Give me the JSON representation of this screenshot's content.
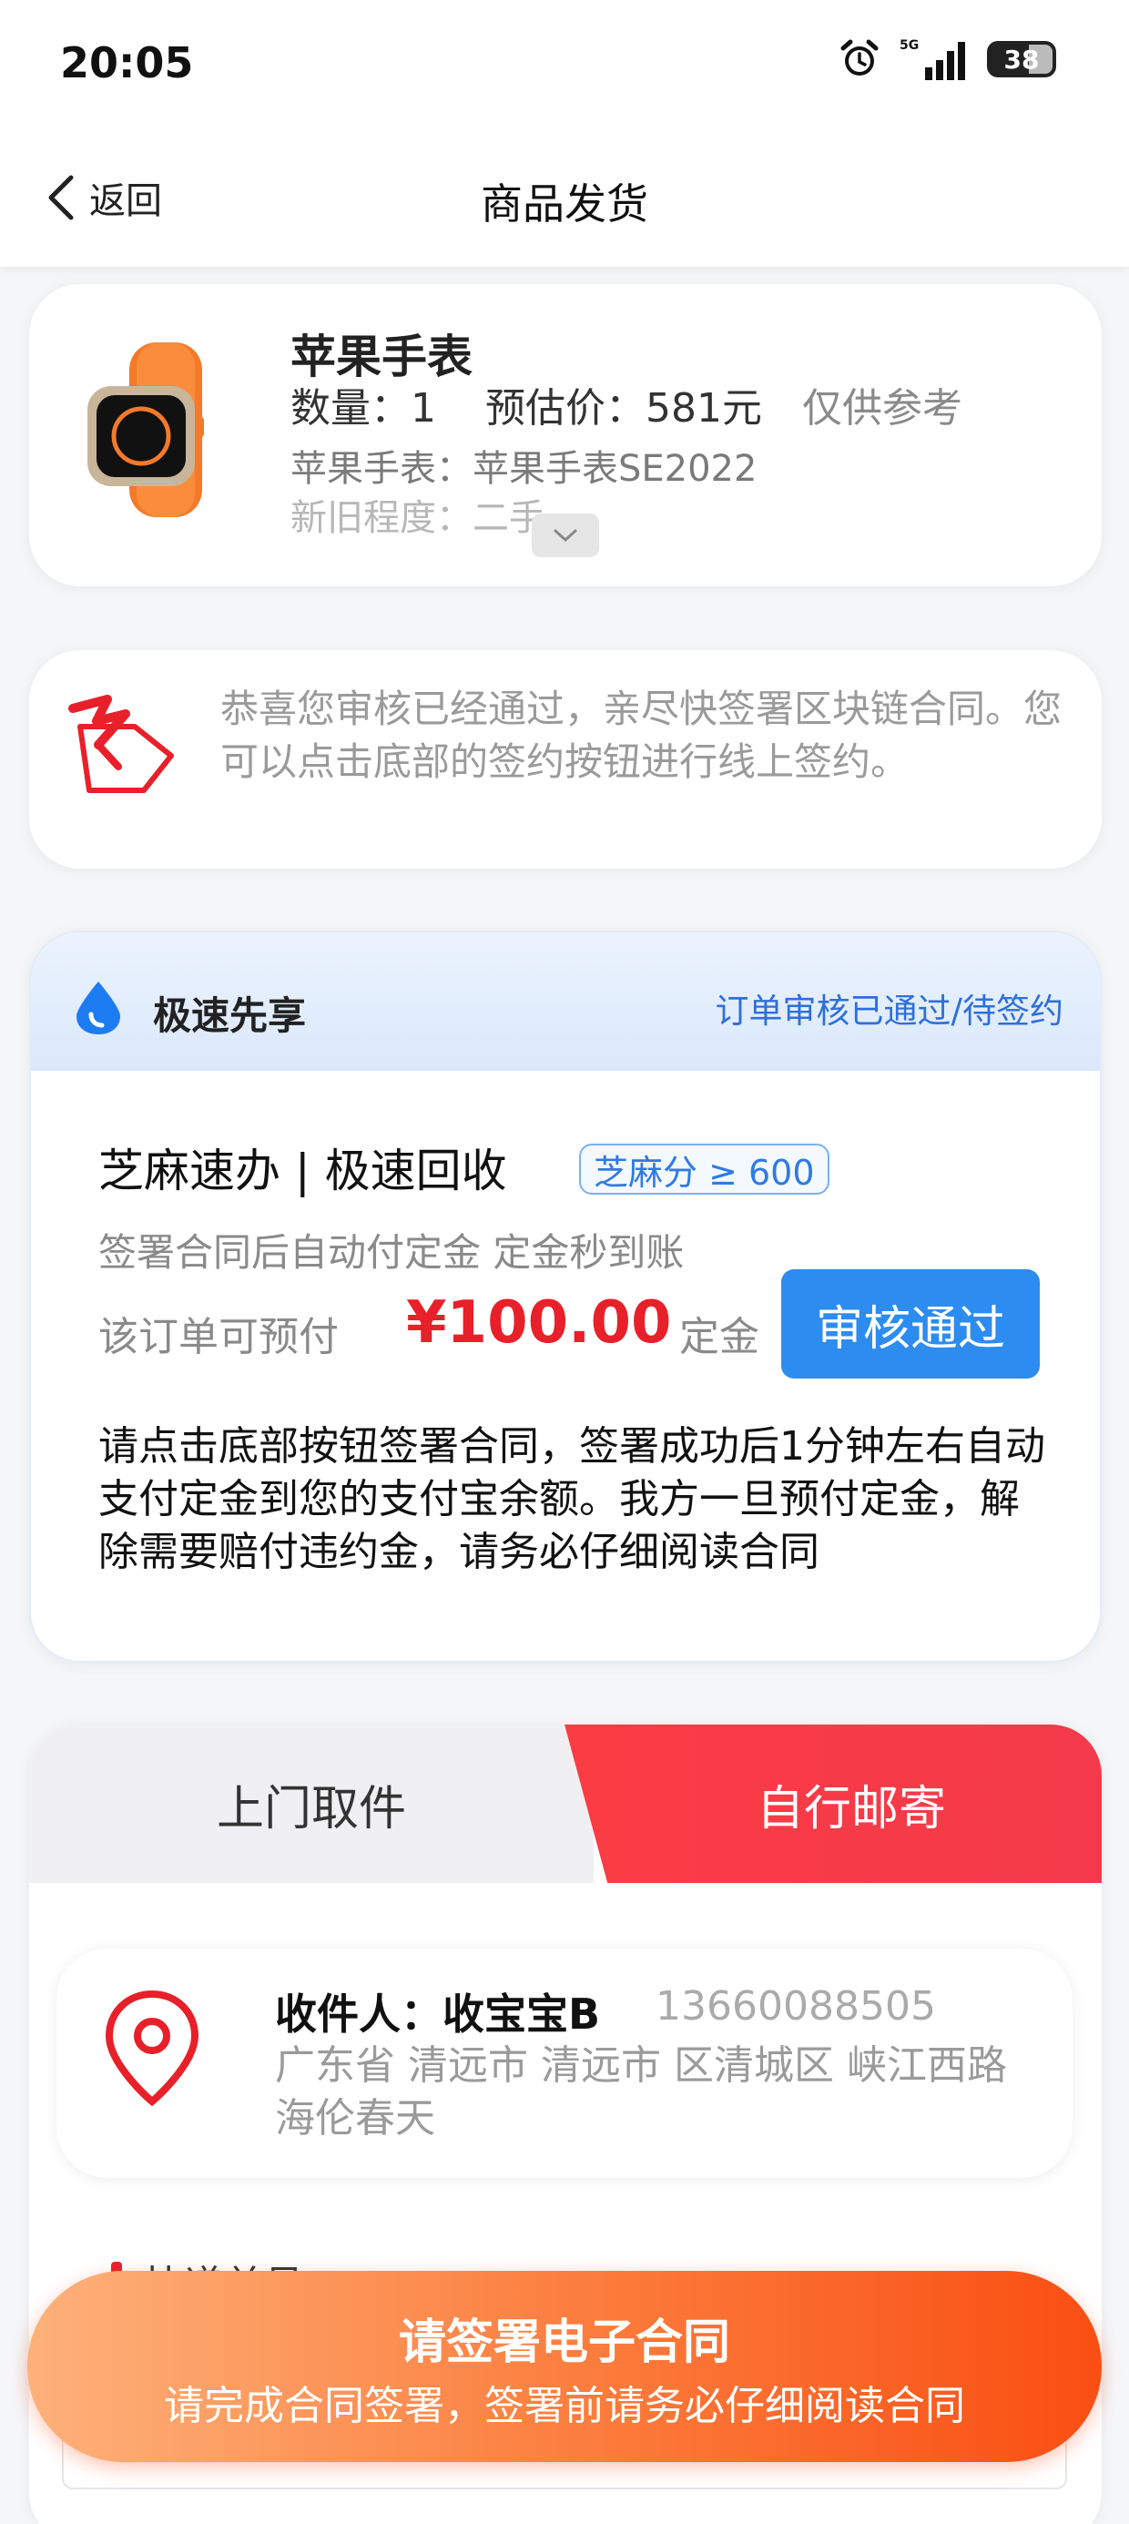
{
  "status_bar": {
    "time": "20:05",
    "network": "5G",
    "battery": "38",
    "icons": [
      "alarm-icon",
      "signal-icon",
      "battery-icon"
    ]
  },
  "nav": {
    "back_label": "返回",
    "title": "商品发货"
  },
  "product": {
    "title": "苹果手表",
    "quantity": "数量：1",
    "estimate": "预估价：581元",
    "reference": "仅供参考",
    "model": "苹果手表：苹果手表SE2022",
    "condition": "新旧程度：二手"
  },
  "notice": {
    "text": "恭喜您审核已经通过，亲尽快签署区块链合同。您可以点击底部的签约按钮进行线上签约。"
  },
  "express": {
    "title": "极速先享",
    "status": "订单审核已通过/待签约",
    "service_title": "芝麻速办 | 极速回收",
    "sesame_badge": "芝麻分 ≥ 600",
    "service_sub": "签署合同后自动付定金 定金秒到账",
    "prepay_label": "该订单可预付",
    "prepay_amount": "¥100.00",
    "deposit_label": "定金",
    "approved_button": "审核通过",
    "description": "请点击底部按钮签署合同，签署成功后1分钟左右自动支付定金到您的支付宝余额。我方一旦预付定金，解除需要赔付违约金，请务必仔细阅读合同"
  },
  "shipping": {
    "tab_pickup": "上门取件",
    "tab_self": "自行邮寄",
    "active_tab": "自行邮寄",
    "receiver": "收件人：收宝宝B",
    "phone": "13660088505",
    "address": "广东省 清远市 清远市 区清城区 峡江西路海伦春天",
    "tracking_label": "快递单号"
  },
  "cta": {
    "title": "请签署电子合同",
    "subtitle": "请完成合同签署，签署前请务必仔细阅读合同"
  },
  "colors": {
    "accent_red": "#e8202a",
    "accent_blue": "#2d8cf0",
    "cta_orange": "#fa4e13"
  }
}
